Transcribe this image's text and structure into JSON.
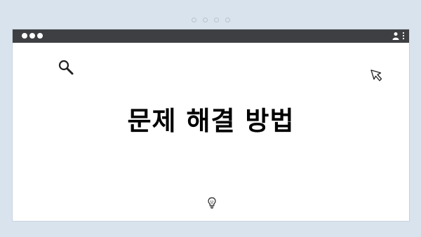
{
  "pagination": {
    "dot_count": 4
  },
  "window": {
    "titlebar_color": "#3d3f42",
    "icons": [
      "window-controls",
      "user-icon",
      "kebab-menu-icon"
    ]
  },
  "content": {
    "headline": "문제 해결 방법",
    "icons": [
      "search-icon",
      "cursor-icon",
      "lightbulb-icon"
    ]
  },
  "colors": {
    "background": "#d9e3ee",
    "window": "#ffffff",
    "text": "#000000"
  }
}
